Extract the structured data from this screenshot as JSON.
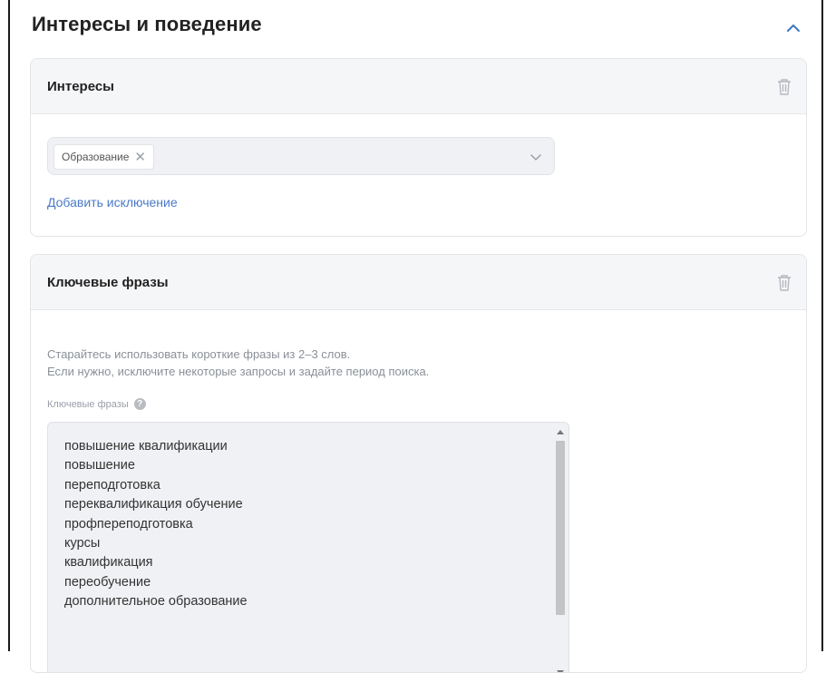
{
  "section": {
    "title": "Интересы и поведение"
  },
  "interests": {
    "title": "Интересы",
    "selected_tag": "Образование",
    "add_exclusion_label": "Добавить исключение"
  },
  "keywords": {
    "title": "Ключевые фразы",
    "hint_line1": "Старайтесь использовать короткие фразы из 2–3 слов.",
    "hint_line2": "Если нужно, исключите некоторые запросы и задайте период поиска.",
    "field_label": "Ключевые фразы",
    "phrases": [
      "повышение квалификации",
      "повышение",
      "переподготовка",
      "переквалификация обучение",
      "профпереподготовка",
      "курсы",
      "квалификация",
      "переобучение",
      "дополнительное образование"
    ]
  },
  "icons": {
    "collapse": "chevron-up-icon",
    "delete": "trash-icon",
    "dropdown": "chevron-down-icon",
    "remove": "close-icon",
    "help": "question-icon"
  },
  "colors": {
    "accent_link": "#4a7ac8",
    "chevron": "#3b78c8",
    "card_header_bg": "#f5f6f8"
  }
}
